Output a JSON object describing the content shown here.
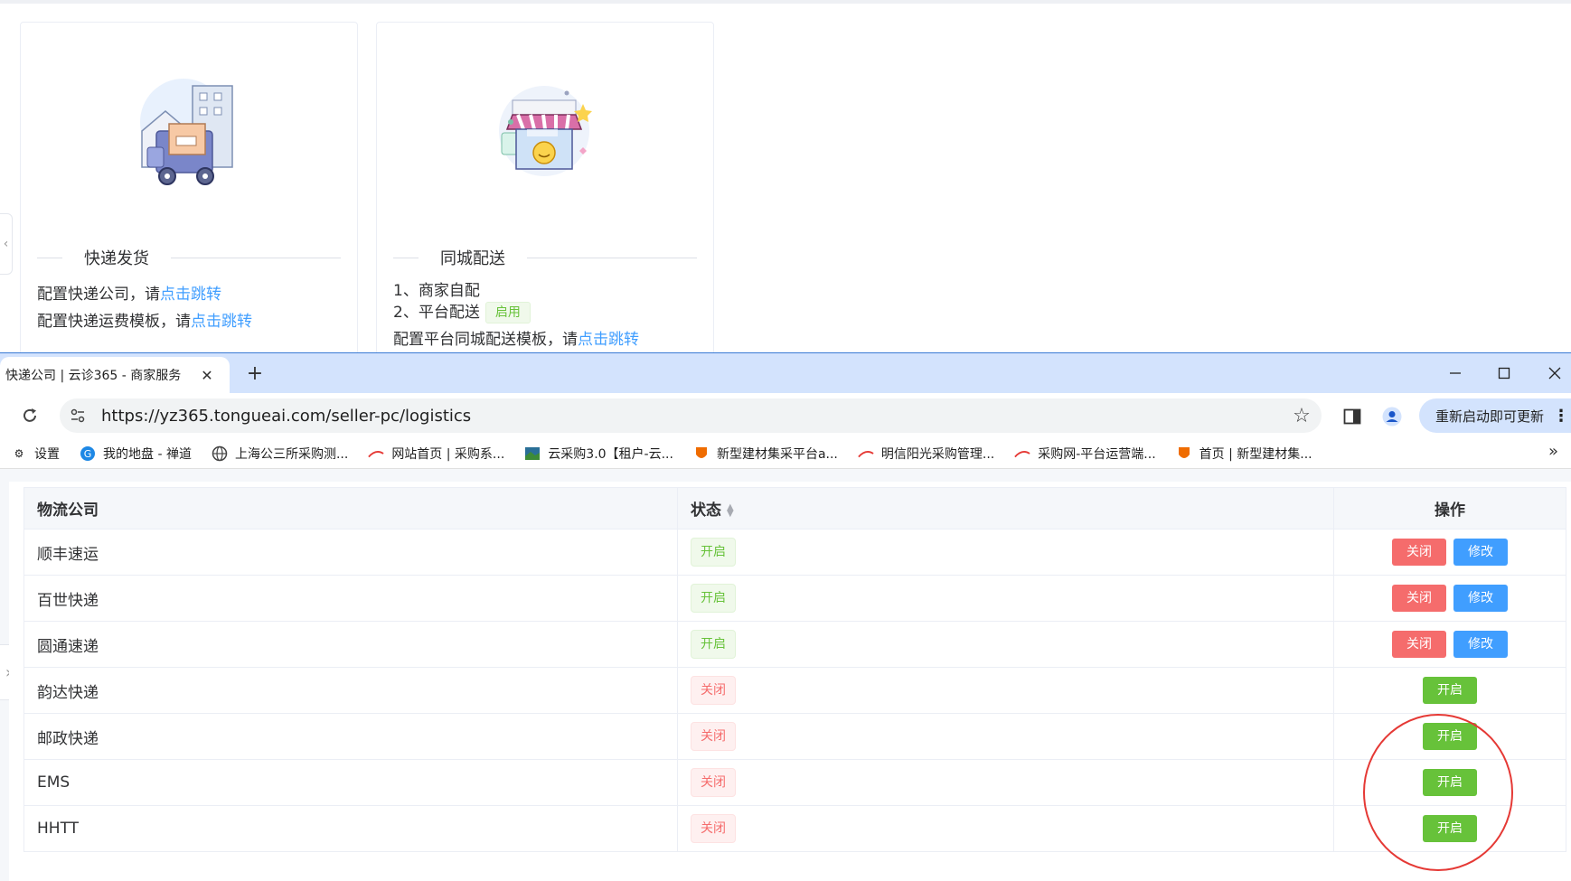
{
  "top_page": {
    "cards": [
      {
        "title": "快递发货",
        "lines": [
          {
            "text": "配置快递公司，请",
            "link": "点击跳转"
          },
          {
            "text": "配置快递运费模板，请",
            "link": "点击跳转"
          }
        ]
      },
      {
        "title": "同城配送",
        "item1": "1、商家自配",
        "item2": "2、平台配送",
        "item2_tag": "启用",
        "line3": {
          "text": "配置平台同城配送模板，请",
          "link": "点击跳转"
        }
      }
    ]
  },
  "browser": {
    "tab_title": "快递公司 | 云诊365 - 商家服务",
    "tab_close": "✕",
    "new_tab": "+",
    "url": "https://yz365.tongueai.com/seller-pc/logistics",
    "update_label": "重新启动即可更新",
    "bookmarks": [
      {
        "label": "设置",
        "icon": "gear-icon"
      },
      {
        "label": "我的地盘 - 禅道",
        "icon": "zentao-icon"
      },
      {
        "label": "上海公三所采购测...",
        "icon": "globe-icon"
      },
      {
        "label": "网站首页 | 采购系...",
        "icon": "brand-icon"
      },
      {
        "label": "云采购3.0【租户-云...",
        "icon": "landscape-icon"
      },
      {
        "label": "新型建材集采平台a...",
        "icon": "shield-icon"
      },
      {
        "label": "明信阳光采购管理...",
        "icon": "brand-icon"
      },
      {
        "label": "采购网-平台运营端...",
        "icon": "brand-icon"
      },
      {
        "label": "首页 | 新型建材集...",
        "icon": "shield-icon"
      }
    ]
  },
  "table": {
    "headers": {
      "company": "物流公司",
      "status": "状态",
      "ops": "操作"
    },
    "labels": {
      "on": "开启",
      "off": "关闭",
      "edit": "修改"
    },
    "rows": [
      {
        "company": "顺丰速运",
        "enabled": true
      },
      {
        "company": "百世快递",
        "enabled": true
      },
      {
        "company": "圆通速递",
        "enabled": true
      },
      {
        "company": "韵达快递",
        "enabled": false
      },
      {
        "company": "邮政快递",
        "enabled": false
      },
      {
        "company": "EMS",
        "enabled": false
      },
      {
        "company": "HHTT",
        "enabled": false
      }
    ]
  },
  "colors": {
    "success": "#67c23a",
    "danger": "#f56c6c",
    "primary": "#409eff",
    "annotation": "#e53935"
  }
}
